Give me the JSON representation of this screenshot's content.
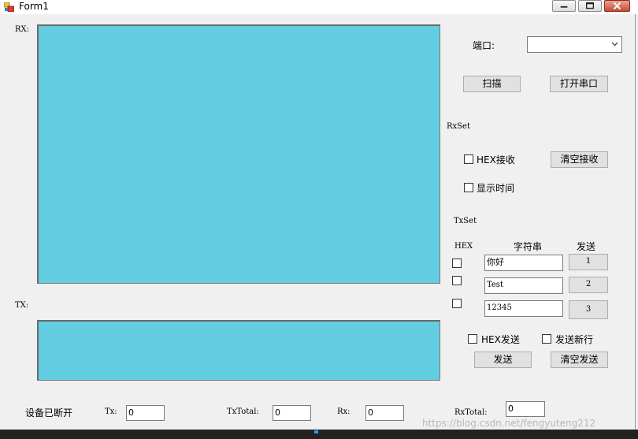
{
  "window": {
    "title": "Form1"
  },
  "rx_label": "RX:",
  "tx_label": "TX:",
  "port": {
    "label": "端口:",
    "value": ""
  },
  "buttons": {
    "scan": "扫描",
    "open_port": "打开串口",
    "clear_rx": "清空接收",
    "send": "发送",
    "clear_tx": "清空发送"
  },
  "rxset": {
    "title": "RxSet",
    "hex_rx": "HEX接收",
    "show_time": "显示时间"
  },
  "txset": {
    "title": "TxSet",
    "col_hex": "HEX",
    "col_string": "字符串",
    "col_send": "发送",
    "rows": [
      {
        "text": "你好",
        "button": "1"
      },
      {
        "text": "Test",
        "button": "2"
      },
      {
        "text": "12345",
        "button": "3"
      }
    ],
    "hex_send": "HEX发送",
    "send_newline": "发送新行"
  },
  "status": {
    "device": "设备已断开",
    "tx_label": "Tx:",
    "tx_value": "0",
    "txtotal_label": "TxTotal:",
    "txtotal_value": "0",
    "rx_label": "Rx:",
    "rx_value": "0",
    "rxtotal_label": "RxTotal:",
    "rxtotal_value": "0"
  },
  "watermark": "https://blog.csdn.net/fengyuteng212"
}
